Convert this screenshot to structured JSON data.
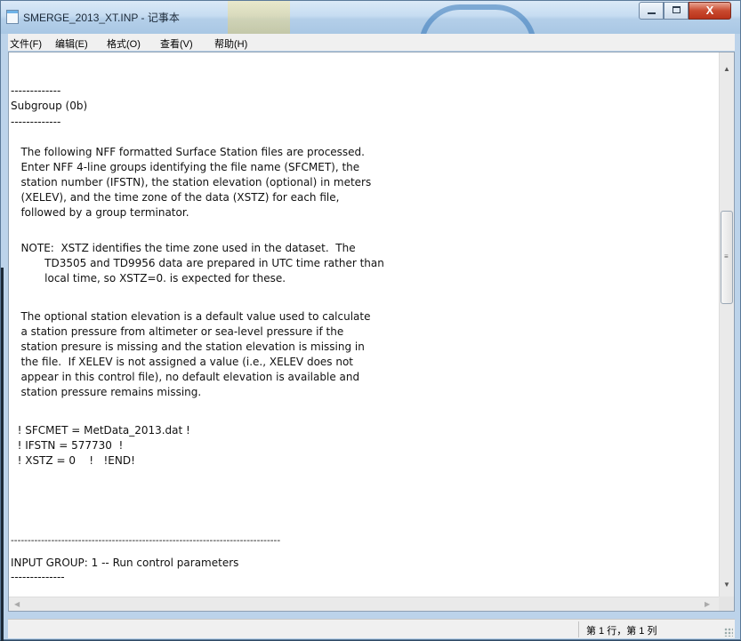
{
  "window": {
    "title": "SMERGE_2013_XT.INP - 记事本",
    "controls": {
      "minimize": "",
      "maximize": "",
      "close": "X"
    }
  },
  "menu": [
    "文件(F)",
    "编辑(E)",
    "格式(O)",
    "查看(V)",
    "帮助(H)"
  ],
  "document": {
    "lines": [
      "-------------",
      "Subgroup (0b)",
      "-------------",
      "",
      "   The following NFF formatted Surface Station files are processed.",
      "   Enter NFF 4-line groups identifying the file name (SFCMET), the",
      "   station number (IFSTN), the station elevation (optional) in meters",
      "   (XELEV), and the time zone of the data (XSTZ) for each file,",
      "   followed by a group terminator.",
      "",
      "   NOTE:  XSTZ identifies the time zone used in the dataset.  The",
      "          TD3505 and TD9956 data are prepared in UTC time rather than",
      "          local time, so XSTZ=0. is expected for these.",
      "",
      "   The optional station elevation is a default value used to calculate",
      "   a station pressure from altimeter or sea-level pressure if the",
      "   station presure is missing and the station elevation is missing in",
      "   the file.  If XELEV is not assigned a value (i.e., XELEV does not",
      "   appear in this control file), no default elevation is available and",
      "   station pressure remains missing.",
      "",
      "  ! SFCMET = MetData_2013.dat !",
      "  ! IFSTN = 577730  !",
      "  ! XSTZ = 0    !   !END!",
      "",
      "",
      "",
      "--------------------------------------------------------------------------------",
      "INPUT GROUP: 1 -- Run control parameters",
      "--------------"
    ]
  },
  "scrollbars": {
    "vertical": {
      "up_arrow": "▲",
      "down_arrow": "▼",
      "thumb_grip": "≡"
    },
    "horizontal": {
      "left_arrow": "◀",
      "right_arrow": "▶"
    }
  },
  "status": {
    "position": "第 1 行，第 1 列"
  }
}
